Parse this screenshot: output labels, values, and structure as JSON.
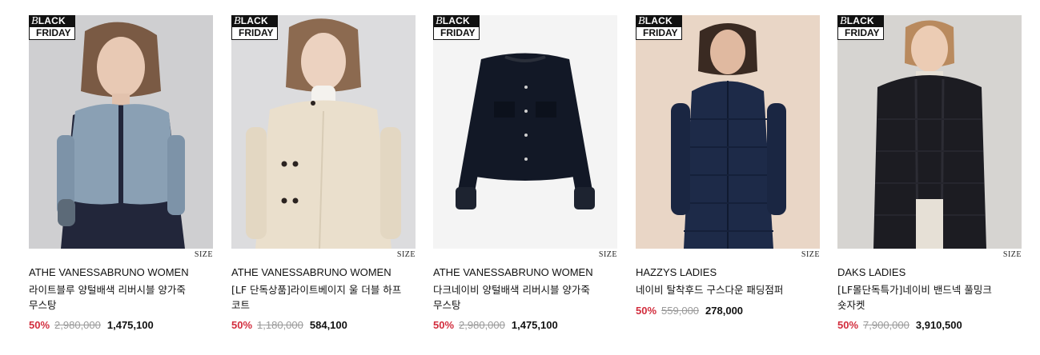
{
  "badge": {
    "top_script": "B",
    "top": "LACK",
    "bottom": "FRIDAY"
  },
  "size_label": "SIZE",
  "products": [
    {
      "brand": "ATHE VANESSABRUNO WOMEN",
      "name": "라이트블루 양털배색 리버시블 양가죽 무스탕",
      "discount": "50%",
      "original_price": "2,980,000",
      "sale_price": "1,475,100",
      "photo": "model-lightblue-shearling-jacket"
    },
    {
      "brand": "ATHE VANESSABRUNO WOMEN",
      "name": "[LF 단독상품]라이트베이지 울 더블 하프 코트",
      "discount": "50%",
      "original_price": "1,180,000",
      "sale_price": "584,100",
      "photo": "model-beige-double-coat"
    },
    {
      "brand": "ATHE VANESSABRUNO WOMEN",
      "name": "다크네이비 양털배색 리버시블 양가죽 무스탕",
      "discount": "50%",
      "original_price": "2,980,000",
      "sale_price": "1,475,100",
      "photo": "darknavy-shearling-jacket-flatlay"
    },
    {
      "brand": "HAZZYS LADIES",
      "name": "네이비 탈착후드 구스다운 패딩점퍼",
      "discount": "50%",
      "original_price": "559,000",
      "sale_price": "278,000",
      "photo": "model-navy-down-coat"
    },
    {
      "brand": "DAKS LADIES",
      "name": "[LF몰단독특가]네이비 밴드넥 풀밍크 숏자켓",
      "discount": "50%",
      "original_price": "7,900,000",
      "sale_price": "3,910,500",
      "photo": "model-navy-mink-jacket"
    }
  ],
  "colors": {
    "discount": "#d22d3d",
    "original_price": "#9a9a9a",
    "text": "#111111"
  }
}
